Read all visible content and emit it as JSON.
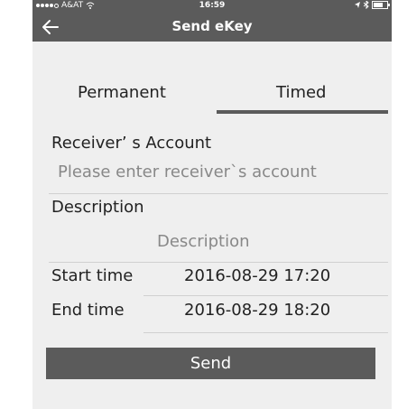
{
  "status_bar": {
    "carrier": "A&AT",
    "time": "16:59"
  },
  "nav": {
    "title": "Send eKey"
  },
  "tabs": [
    {
      "label": "Permanent"
    },
    {
      "label": "Timed"
    }
  ],
  "form": {
    "receiver_label": "Receiver’ s Account",
    "receiver_placeholder": "Please enter receiver`s account",
    "description_label": "Description",
    "description_placeholder": "Description",
    "start_time_label": "Start time",
    "start_time_value": "2016-08-29 17:20",
    "end_time_label": "End time",
    "end_time_value": "2016-08-29 18:20"
  },
  "send_button": {
    "label": "Send"
  },
  "colors": {
    "bar": "#5b5b5b",
    "background": "#efefef"
  }
}
